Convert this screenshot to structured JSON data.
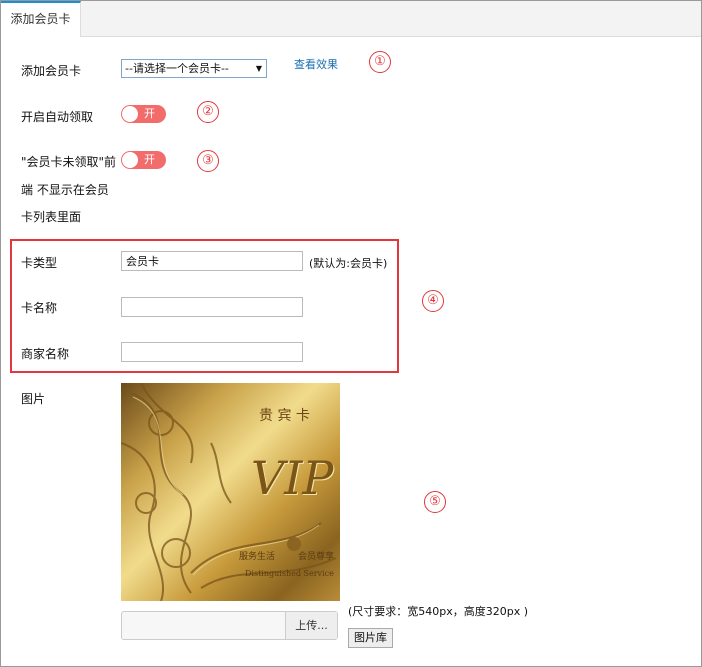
{
  "tab": {
    "label": "添加会员卡"
  },
  "form": {
    "add_card": {
      "label": "添加会员卡",
      "select_value": "--请选择一个会员卡--",
      "preview_link": "查看效果",
      "marker": "①"
    },
    "auto_claim": {
      "label": "开启自动领取",
      "toggle_text": "开",
      "marker": "②"
    },
    "hide_unclaimed": {
      "label_line1": "\"会员卡未领取\"前",
      "label_line2": "端 不显示在会员",
      "label_line3": "卡列表里面",
      "toggle_text": "开",
      "marker": "③"
    },
    "card_type": {
      "label": "卡类型",
      "value": "会员卡",
      "hint": "(默认为:会员卡)"
    },
    "card_name": {
      "label": "卡名称",
      "value": ""
    },
    "merchant_name": {
      "label": "商家名称",
      "value": ""
    },
    "section_marker": "④",
    "image": {
      "label": "图片",
      "card_title": "贵 宾 卡",
      "card_vip": "VIP",
      "card_brand_left": "服务生活",
      "card_brand_right": "会员尊享",
      "card_service": "Distinguished Service",
      "size_hint": "(尺寸要求：宽540px，高度320px )",
      "upload_label": "上传...",
      "library_label": "图片库",
      "marker": "⑤"
    }
  },
  "colors": {
    "toggle_on": "#f26c6c",
    "annotation_red": "#e2373a",
    "link": "#1a6fb0",
    "tab_accent": "#1a8fd8"
  }
}
